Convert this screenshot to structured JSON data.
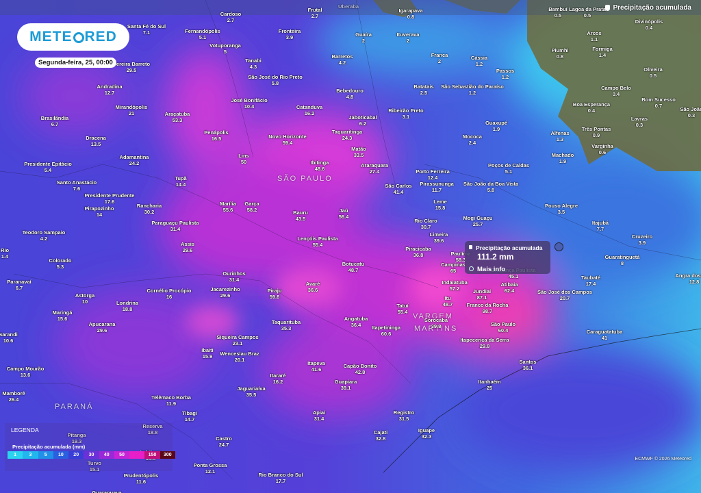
{
  "brand": {
    "name_pre": "METE",
    "name_post": "RED"
  },
  "date_label": "Segunda-feira, 25, 00:00",
  "layer_title": "Precipitação acumulada",
  "regions": [
    {
      "label": "SÃO PAULO"
    },
    {
      "label": "PARANÁ"
    },
    {
      "label": "VARGEM"
    },
    {
      "label": "MARTINS"
    }
  ],
  "cities": [
    {
      "name": "Cardoso",
      "value": "2.7"
    },
    {
      "name": "Santa Fé do Sul",
      "value": "7.1"
    },
    {
      "name": "Fernandópolis",
      "value": "5.1"
    },
    {
      "name": "Votuporanga",
      "value": "5"
    },
    {
      "name": "Fronteira",
      "value": "3.9"
    },
    {
      "name": "Guaíra",
      "value": "2"
    },
    {
      "name": "Ituverava",
      "value": "2"
    },
    {
      "name": "Igarapava",
      "value": "0.8"
    },
    {
      "name": "Pereira Barreto",
      "value": "29.5"
    },
    {
      "name": "Tanabi",
      "value": "4.3"
    },
    {
      "name": "São José do Rio Preto",
      "value": "5.8"
    },
    {
      "name": "Barretos",
      "value": "4.2"
    },
    {
      "name": "Franca",
      "value": "2"
    },
    {
      "name": "Cássia",
      "value": "1.2"
    },
    {
      "name": "Passos",
      "value": "1.2"
    },
    {
      "name": "Andradina",
      "value": "12.7"
    },
    {
      "name": "Mirandópolis",
      "value": "21"
    },
    {
      "name": "José Bonifácio",
      "value": "10.4"
    },
    {
      "name": "Catanduva",
      "value": "16.2"
    },
    {
      "name": "Bebedouro",
      "value": "4.8"
    },
    {
      "name": "Batatais",
      "value": "2.5"
    },
    {
      "name": "São Sebastião do Paraíso",
      "value": "1.2"
    },
    {
      "name": "Jaboticabal",
      "value": "6.2"
    },
    {
      "name": "Ribeirão Preto",
      "value": "3.1"
    },
    {
      "name": "Araçatuba",
      "value": "53.3"
    },
    {
      "name": "Brasilândia",
      "value": "6.7"
    },
    {
      "name": "Penápolis",
      "value": "16.5"
    },
    {
      "name": "Taquaritinga",
      "value": "24.3"
    },
    {
      "name": "Guaxupé",
      "value": "1.9"
    },
    {
      "name": "Dracena",
      "value": "13.5"
    },
    {
      "name": "Novo Horizonte",
      "value": "59.4"
    },
    {
      "name": "Matão",
      "value": "33.5"
    },
    {
      "name": "Mococa",
      "value": "2.4"
    },
    {
      "name": "Alfenas",
      "value": "1.3"
    },
    {
      "name": "Machado",
      "value": "1.9"
    },
    {
      "name": "Adamantina",
      "value": "24.2"
    },
    {
      "name": "Lins",
      "value": "50"
    },
    {
      "name": "Ibitinga",
      "value": "48.6"
    },
    {
      "name": "Araraquara",
      "value": "27.4"
    },
    {
      "name": "Porto Ferreira",
      "value": "12.4"
    },
    {
      "name": "Poços de Caldas",
      "value": "5.1"
    },
    {
      "name": "Presidente Epitácio",
      "value": "5.4"
    },
    {
      "name": "Tupã",
      "value": "14.4"
    },
    {
      "name": "São Carlos",
      "value": "41.4"
    },
    {
      "name": "Pirassununga",
      "value": "11.7"
    },
    {
      "name": "São João da Boa Vista",
      "value": "5.8"
    },
    {
      "name": "Santo Anastácio",
      "value": "7.6"
    },
    {
      "name": "Presidente Prudente",
      "value": "17.6"
    },
    {
      "name": "Rancharia",
      "value": "30.2"
    },
    {
      "name": "Marília",
      "value": "55.6"
    },
    {
      "name": "Garça",
      "value": "58.2"
    },
    {
      "name": "Leme",
      "value": "15.8"
    },
    {
      "name": "Pouso Alegre",
      "value": "3.5"
    },
    {
      "name": "Pirapozinho",
      "value": "14"
    },
    {
      "name": "Paraguaçu Paulista",
      "value": "31.4"
    },
    {
      "name": "Bauru",
      "value": "43.5"
    },
    {
      "name": "Jaú",
      "value": "56.4"
    },
    {
      "name": "Rio Claro",
      "value": "30.7"
    },
    {
      "name": "Mogi Guaçu",
      "value": "25.7"
    },
    {
      "name": "Itajubá",
      "value": "7.7"
    },
    {
      "name": "Teodoro Sampaio",
      "value": "4.2"
    },
    {
      "name": "Lençóis Paulista",
      "value": "55.4"
    },
    {
      "name": "Limeira",
      "value": "39.6"
    },
    {
      "name": "Cruzeiro",
      "value": "3.9"
    },
    {
      "name": "Assis",
      "value": "29.6"
    },
    {
      "name": "Piracicaba",
      "value": "36.8"
    },
    {
      "name": "Paulínia",
      "value": "58.3"
    },
    {
      "name": "Colorado",
      "value": "5.3"
    },
    {
      "name": "Rio",
      "value": "1.4"
    },
    {
      "name": "Botucatu",
      "value": "48.7"
    },
    {
      "name": "Guaratinguetá",
      "value": "8"
    },
    {
      "name": "Campinas",
      "value": "65"
    },
    {
      "name": "Bragança Paulista",
      "value": "45.1"
    },
    {
      "name": "Ourinhos",
      "value": "31.4"
    },
    {
      "name": "Paranavaí",
      "value": "6.7"
    },
    {
      "name": "Jacarezinho",
      "value": "29.6"
    },
    {
      "name": "Avaré",
      "value": "36.6"
    },
    {
      "name": "Indaiatuba",
      "value": "57.2"
    },
    {
      "name": "Atibaia",
      "value": "62.4"
    },
    {
      "name": "Taubaté",
      "value": "17.4"
    },
    {
      "name": "Cornélio Procópio",
      "value": "16"
    },
    {
      "name": "Piraju",
      "value": "59.8"
    },
    {
      "name": "Jundiaí",
      "value": "87.1"
    },
    {
      "name": "São José dos Campos",
      "value": "20.7"
    },
    {
      "name": "Angra dos Reis",
      "value": "12.8"
    },
    {
      "name": "Astorga",
      "value": "10"
    },
    {
      "name": "Londrina",
      "value": "18.8"
    },
    {
      "name": "Itu",
      "value": "48.7"
    },
    {
      "name": "Franco da Rocha",
      "value": "98.7"
    },
    {
      "name": "Tatuí",
      "value": "55.4"
    },
    {
      "name": "Maringá",
      "value": "15.6"
    },
    {
      "name": "Apucarana",
      "value": "29.6"
    },
    {
      "name": "Angatuba",
      "value": "36.4"
    },
    {
      "name": "Sorocaba",
      "value": "39.8"
    },
    {
      "name": "São Paulo",
      "value": "60.4"
    },
    {
      "name": "Taquarituba",
      "value": "35.3"
    },
    {
      "name": "Itapetininga",
      "value": "60.6"
    },
    {
      "name": "Caraguatatuba",
      "value": "41"
    },
    {
      "name": "Siqueira Campos",
      "value": "23.1"
    },
    {
      "name": "Itapecerica da Serra",
      "value": "29.8"
    },
    {
      "name": "Sarandi",
      "value": "10.6"
    },
    {
      "name": "Ibaiti",
      "value": "15.9"
    },
    {
      "name": "Wenceslau Braz",
      "value": "20.1"
    },
    {
      "name": "Santos",
      "value": "36.1"
    },
    {
      "name": "Campo Mourão",
      "value": "13.6"
    },
    {
      "name": "Itapeva",
      "value": "41.6"
    },
    {
      "name": "Capão Bonito",
      "value": "42.8"
    },
    {
      "name": "Itararé",
      "value": "16.2"
    },
    {
      "name": "Guapiara",
      "value": "39.1"
    },
    {
      "name": "Itanhaém",
      "value": "25"
    },
    {
      "name": "Mamborê",
      "value": "26.4"
    },
    {
      "name": "Jaguariaíva",
      "value": "35.5"
    },
    {
      "name": "Telêmaco Borba",
      "value": "11.9"
    },
    {
      "name": "Apiaí",
      "value": "31.4"
    },
    {
      "name": "Registro",
      "value": "31.5"
    },
    {
      "name": "Tibagi",
      "value": "14.7"
    },
    {
      "name": "Reserva",
      "value": "18.8"
    },
    {
      "name": "Iguape",
      "value": "32.3"
    },
    {
      "name": "Cajati",
      "value": "32.8"
    },
    {
      "name": "Pitanga",
      "value": "19.3"
    },
    {
      "name": "Castro",
      "value": "24.7"
    },
    {
      "name": "Ponta Grossa",
      "value": "12.1"
    },
    {
      "name": "Rio Branco do Sul",
      "value": "17.7"
    },
    {
      "name": "Prudentópolis",
      "value": "11.6"
    },
    {
      "name": "Guarapuava",
      "value": ""
    },
    {
      "name": "Turvo",
      "value": "15.1"
    },
    {
      "name": "Imbituva",
      "value": "13.3"
    },
    {
      "name": "Bambuí",
      "value": "0.5"
    },
    {
      "name": "Lagoa da Prata",
      "value": "0.5"
    },
    {
      "name": "Divinópolis",
      "value": "0.4"
    },
    {
      "name": "Arcos",
      "value": "1.1"
    },
    {
      "name": "Piumhi",
      "value": "0.8"
    },
    {
      "name": "Formiga",
      "value": "1.4"
    },
    {
      "name": "Oliveira",
      "value": "0.5"
    },
    {
      "name": "Campo Belo",
      "value": "0.4"
    },
    {
      "name": "Bom Sucesso",
      "value": "0.7"
    },
    {
      "name": "Boa Esperança",
      "value": "0.4"
    },
    {
      "name": "São João",
      "value": "0.3"
    },
    {
      "name": "Três Pontas",
      "value": "0.9"
    },
    {
      "name": "Lavras",
      "value": "0.3"
    },
    {
      "name": "Varginha",
      "value": "0.6"
    },
    {
      "name": "Frutal",
      "value": "2.7"
    },
    {
      "name": "Uberaba",
      "value": ""
    }
  ],
  "popup": {
    "title": "Precipitação acumulada",
    "value": "111.2 mm",
    "more": "Mais info"
  },
  "legend": {
    "title": "LEGENDA",
    "subtitle": "Precipitação acumulada (mm)",
    "steps": [
      {
        "label": "1",
        "color": "#2bd3f0"
      },
      {
        "label": "3",
        "color": "#22b6ee"
      },
      {
        "label": "5",
        "color": "#2190e8"
      },
      {
        "label": "10",
        "color": "#2a5fe0"
      },
      {
        "label": "20",
        "color": "#3a3ed6"
      },
      {
        "label": "30",
        "color": "#6b31d8"
      },
      {
        "label": "40",
        "color": "#9a28d8"
      },
      {
        "label": "50",
        "color": "#c624d6"
      },
      {
        "label": "",
        "color": "#e81fc8"
      },
      {
        "label": "150",
        "color": "#c0107a"
      },
      {
        "label": "300",
        "color": "#5a0818"
      }
    ]
  },
  "credit": "ECMWF © 2026 Meteored",
  "colors": {
    "land": "#6f6a3a",
    "brand": "#1c9bd6"
  }
}
